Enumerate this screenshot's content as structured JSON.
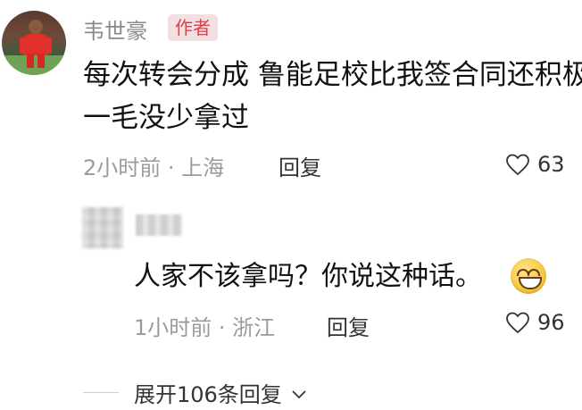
{
  "comment": {
    "author": "韦世豪",
    "author_badge": "作者",
    "text": "每次转会分成 鲁能足校比我签合同还积极\n一毛没少拿过",
    "time": "2小时前",
    "location": "上海",
    "reply_label": "回复",
    "likes": "63"
  },
  "reply": {
    "username": "用户",
    "text": "人家不该拿吗？你说这种话。",
    "emoji": "smiling-face-emoji",
    "time": "1小时前",
    "location": "浙江",
    "reply_label": "回复",
    "likes": "96"
  },
  "expand": {
    "label": "展开106条回复"
  },
  "icons": [
    "heart-outline-icon",
    "chevron-down-icon"
  ]
}
